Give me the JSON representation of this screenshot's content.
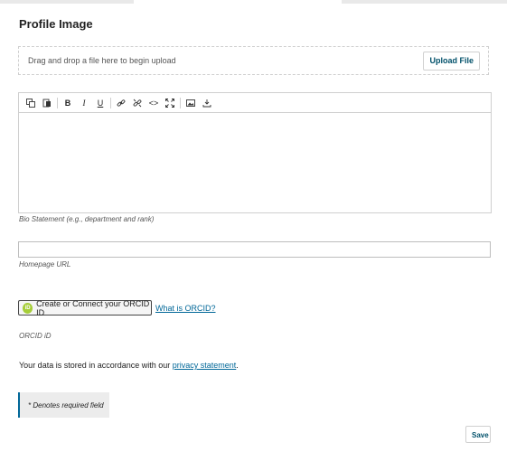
{
  "form": {
    "section_title": "Profile Image",
    "dropzone_hint": "Drag and drop a file here to begin upload",
    "upload_button": "Upload File",
    "bio_caption": "Bio Statement (e.g., department and rank)",
    "homepage_caption": "Homepage URL",
    "homepage_value": "",
    "orcid_button": "Create or Connect your ORCID ID",
    "orcid_badge": "iD",
    "orcid_link": "What is ORCID?",
    "orcid_caption": "ORCID iD",
    "privacy_prefix": "Your data is stored in accordance with our ",
    "privacy_link": "privacy statement",
    "privacy_suffix": ".",
    "required_note": "* Denotes required field",
    "save_button": "Save"
  },
  "toolbar": {
    "buttons": [
      "copy-icon",
      "paste-icon",
      "bold-icon",
      "italic-icon",
      "underline-icon",
      "link-icon",
      "unlink-icon",
      "code-icon",
      "fullscreen-icon",
      "image-icon",
      "download-icon"
    ],
    "bold_glyph": "B",
    "italic_glyph": "I",
    "underline_glyph": "U",
    "code_glyph": "<>"
  },
  "colors": {
    "link": "#006798",
    "button_text": "#00506a",
    "orcid": "#a6ce39"
  }
}
